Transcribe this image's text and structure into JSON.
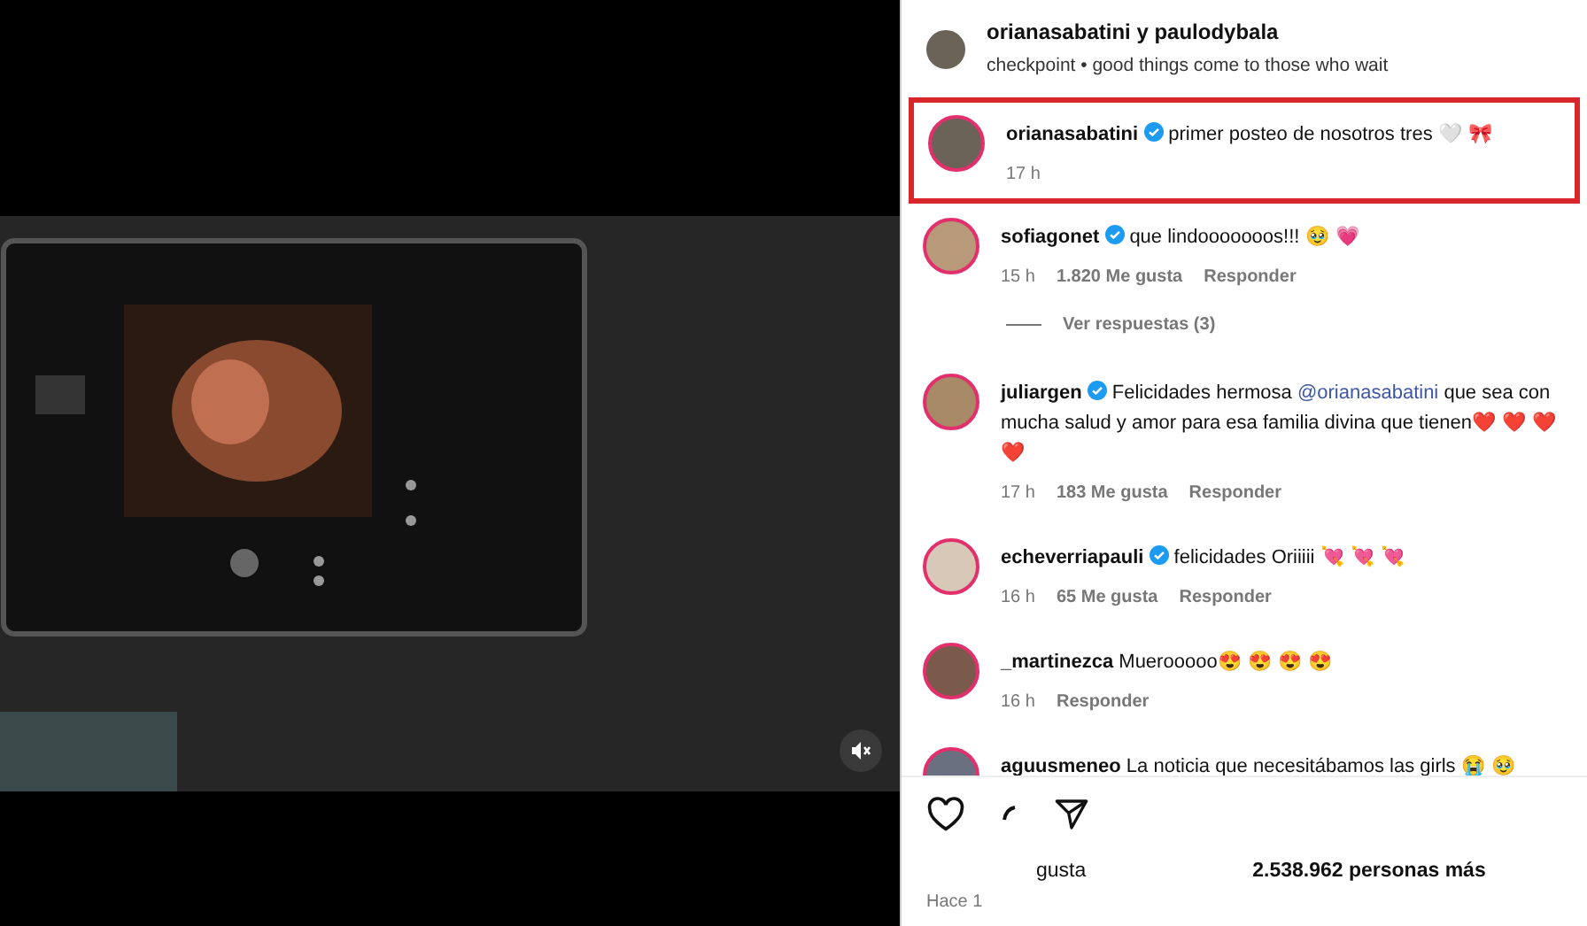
{
  "post_header": {
    "authors": "orianasabatini y paulodybala",
    "subtitle": "checkpoint • good things come to those who wait"
  },
  "comments": [
    {
      "username": "orianasabatini",
      "verified": true,
      "text": "primer posteo de nosotros tres 🤍 🎀",
      "time": "17 h",
      "highlighted": true
    },
    {
      "username": "sofiagonet",
      "verified": true,
      "text": "que lindooooooos!!! 🥹 💗",
      "time": "15 h",
      "likes": "1.820 Me gusta",
      "reply": "Responder",
      "view_replies": "Ver respuestas (3)",
      "highlighted": false
    },
    {
      "username": "juliargen",
      "verified": true,
      "text": "Felicidades hermosa",
      "mention": "@orianasabatini",
      "text_after": "que sea con mucha salud y amor para esa familia divina que tienen❤️ ❤️ ❤️ ❤️",
      "time": "17 h",
      "likes": "183 Me gusta",
      "reply": "Responder",
      "highlighted": false
    },
    {
      "username": "echeverriapauli",
      "verified": true,
      "text": "felicidades Oriiiii 💘 💘 💘",
      "time": "16 h",
      "likes": "65 Me gusta",
      "reply": "Responder",
      "highlighted": false
    },
    {
      "username": "_martinezca",
      "verified": false,
      "text": "Muerooooo😍 😍 😍 😍",
      "time": "16 h",
      "reply": "Responder",
      "highlighted": false
    },
    {
      "username": "aguusmeneo",
      "verified": false,
      "text": "La noticia que necesitábamos las girls 😭 🥹",
      "highlighted": false
    }
  ],
  "likes_line": {
    "part_1": "gusta",
    "part_2": "2.538.962 personas más"
  },
  "post_time": "Hace 1"
}
